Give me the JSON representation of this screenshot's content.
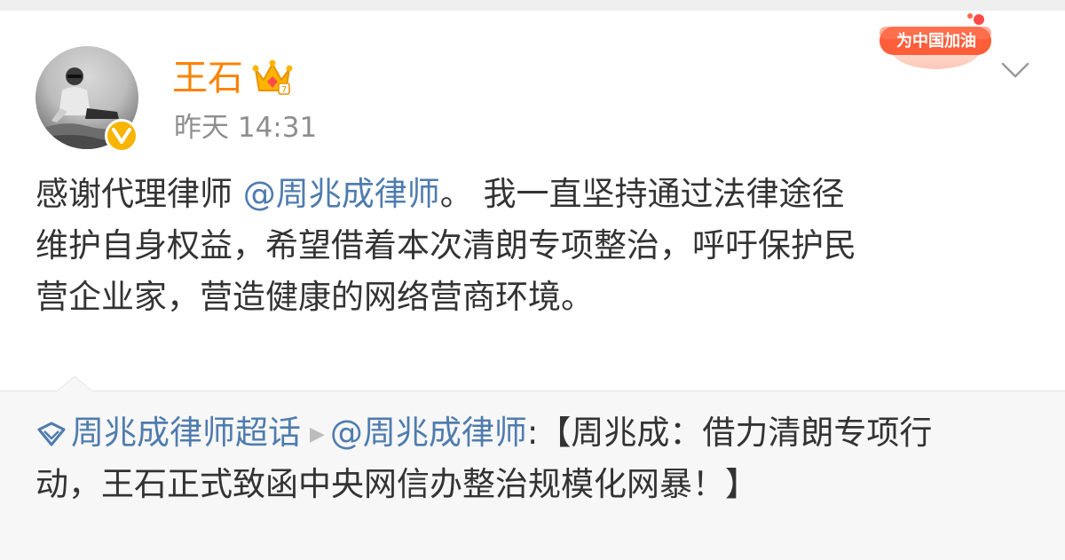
{
  "user": {
    "name": "王石",
    "time": "昨天 14:31"
  },
  "badge": {
    "text": "为中国加油"
  },
  "post": {
    "line1_text": "感谢代理律师 ",
    "line1_mention": "@周兆成律师",
    "line1_rest": "。 我一直坚持通过法律途径",
    "line2": "维护自身权益，希望借着本次清朗专项整治，呼吁保护民",
    "line3": "营企业家，营造健康的网络营商环境。"
  },
  "quote": {
    "topic": "周兆成律师超话",
    "mention": "@周兆成律师",
    "line1_rest": ":【周兆成：借力清朗专项行",
    "line2": "动，王石正式致函中央网信办整治规模化网暴！】"
  },
  "icons": {
    "verified": "verified-v-icon",
    "crown": "vip-crown-icon",
    "more": "chevron-down-icon",
    "topic": "supertopic-diamond-icon",
    "arrow": "play-triangle-icon"
  },
  "colors": {
    "accent": "#ff8200",
    "link": "#4f7cae",
    "text": "#333333",
    "muted": "#8e8e8e"
  }
}
